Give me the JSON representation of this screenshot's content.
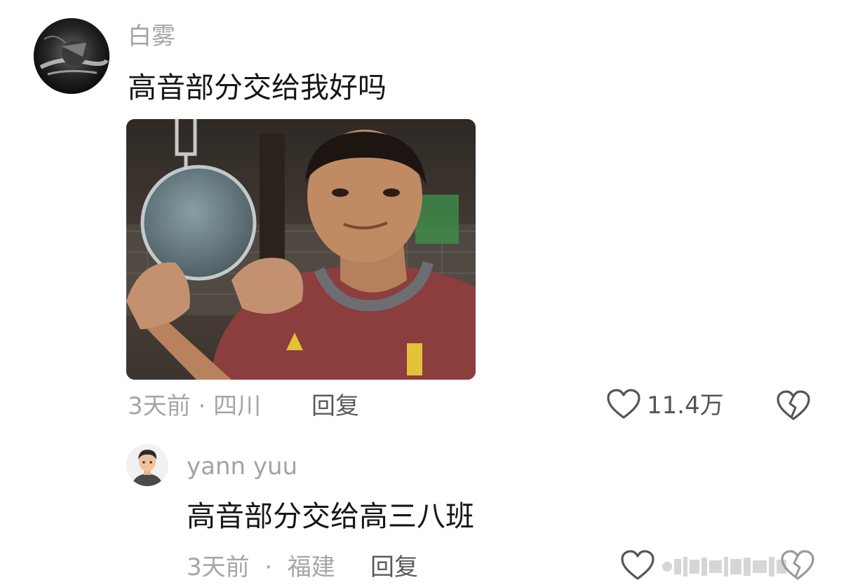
{
  "comment": {
    "author": "白雾",
    "text": "高音部分交给我好吗",
    "time": "3天前",
    "location": "四川",
    "reply_label": "回复",
    "like_count": "11.4万",
    "icons": {
      "like": "heart-icon",
      "dislike": "broken-heart-icon"
    }
  },
  "reply": {
    "author": "yann yuu",
    "text": "高音部分交给高三八班",
    "time": "3天前",
    "location": "福建",
    "reply_label": "回复",
    "icons": {
      "like": "heart-icon",
      "dislike": "broken-heart-icon"
    }
  },
  "colors": {
    "username": "#a3a3a3",
    "text": "#161616",
    "meta": "#a6a6a6",
    "reply_link": "#5a5a5a"
  }
}
